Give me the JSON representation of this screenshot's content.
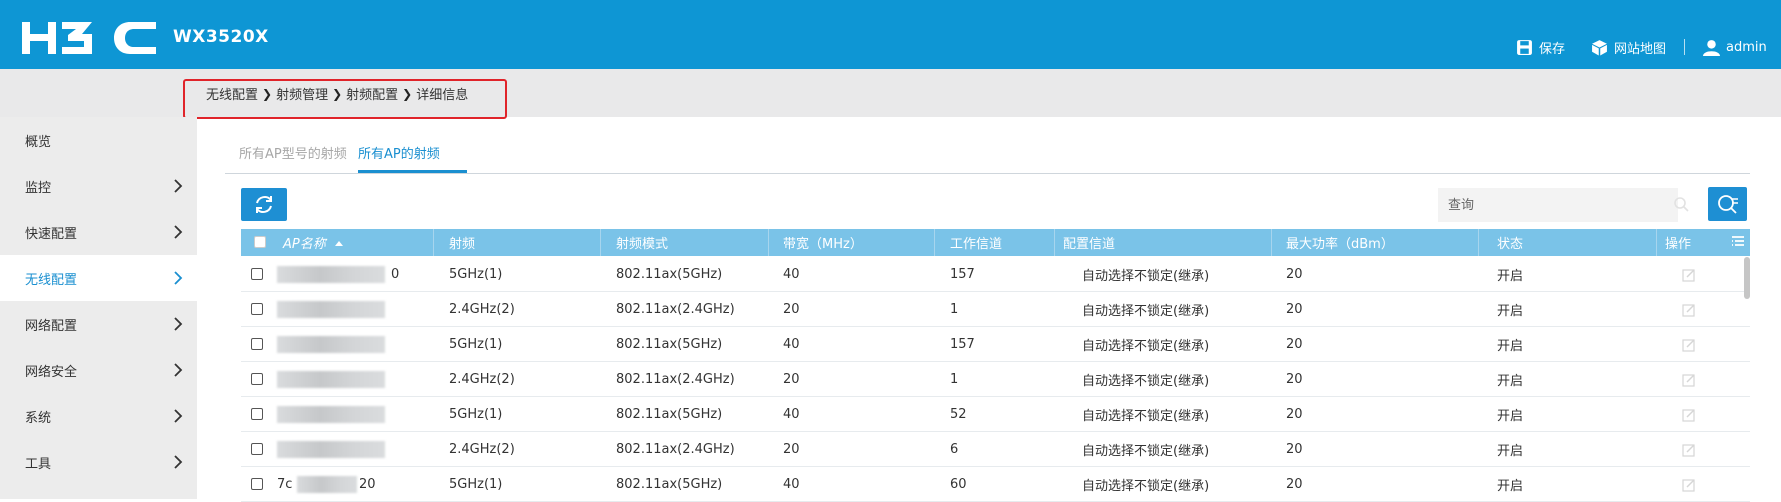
{
  "header": {
    "model": "WX3520X",
    "save_label": "保存",
    "sitemap_label": "网站地图",
    "user_label": "admin"
  },
  "breadcrumb": {
    "items": [
      "无线配置",
      "射频管理",
      "射频配置",
      "详细信息"
    ]
  },
  "sidebar": {
    "items": [
      {
        "label": "概览",
        "active": false,
        "has_arrow": false
      },
      {
        "label": "监控",
        "active": false,
        "has_arrow": true
      },
      {
        "label": "快速配置",
        "active": false,
        "has_arrow": true
      },
      {
        "label": "无线配置",
        "active": true,
        "has_arrow": true
      },
      {
        "label": "网络配置",
        "active": false,
        "has_arrow": true
      },
      {
        "label": "网络安全",
        "active": false,
        "has_arrow": true
      },
      {
        "label": "系统",
        "active": false,
        "has_arrow": true
      },
      {
        "label": "工具",
        "active": false,
        "has_arrow": true
      }
    ]
  },
  "tabs": [
    {
      "label": "所有AP型号的射频",
      "active": false
    },
    {
      "label": "所有AP的射频",
      "active": true
    }
  ],
  "toolbar": {
    "search_placeholder": "查询"
  },
  "table": {
    "columns": [
      "AP名称",
      "射频",
      "射频模式",
      "带宽（MHz）",
      "工作信道",
      "配置信道",
      "最大功率（dBm）",
      "状态",
      "操作"
    ],
    "sort_column": "AP名称",
    "sort_direction": "ascending",
    "rows": [
      {
        "ap_name_visible": "0",
        "radio": "5GHz(1)",
        "mode": "802.11ax(5GHz)",
        "bandwidth": "40",
        "channel": "157",
        "config_channel": "自动选择不锁定(继承)",
        "max_power": "20",
        "status": "开启"
      },
      {
        "ap_name_visible": "",
        "radio": "2.4GHz(2)",
        "mode": "802.11ax(2.4GHz)",
        "bandwidth": "20",
        "channel": "1",
        "config_channel": "自动选择不锁定(继承)",
        "max_power": "20",
        "status": "开启"
      },
      {
        "ap_name_visible": "",
        "radio": "5GHz(1)",
        "mode": "802.11ax(5GHz)",
        "bandwidth": "40",
        "channel": "157",
        "config_channel": "自动选择不锁定(继承)",
        "max_power": "20",
        "status": "开启"
      },
      {
        "ap_name_visible": "",
        "radio": "2.4GHz(2)",
        "mode": "802.11ax(2.4GHz)",
        "bandwidth": "20",
        "channel": "1",
        "config_channel": "自动选择不锁定(继承)",
        "max_power": "20",
        "status": "开启"
      },
      {
        "ap_name_visible": "",
        "radio": "5GHz(1)",
        "mode": "802.11ax(5GHz)",
        "bandwidth": "40",
        "channel": "52",
        "config_channel": "自动选择不锁定(继承)",
        "max_power": "20",
        "status": "开启"
      },
      {
        "ap_name_visible": "",
        "radio": "2.4GHz(2)",
        "mode": "802.11ax(2.4GHz)",
        "bandwidth": "20",
        "channel": "6",
        "config_channel": "自动选择不锁定(继承)",
        "max_power": "20",
        "status": "开启"
      },
      {
        "ap_name_visible": "7c",
        "ap_name_visible_end": "20",
        "radio": "5GHz(1)",
        "mode": "802.11ax(5GHz)",
        "bandwidth": "40",
        "channel": "60",
        "config_channel": "自动选择不锁定(继承)",
        "max_power": "20",
        "status": "开启"
      }
    ]
  },
  "colors": {
    "header_bg": "#0e96d4",
    "accent": "#1a8fd0",
    "table_header_bg": "#7ac3e8",
    "highlight_box": "#e0242a"
  }
}
